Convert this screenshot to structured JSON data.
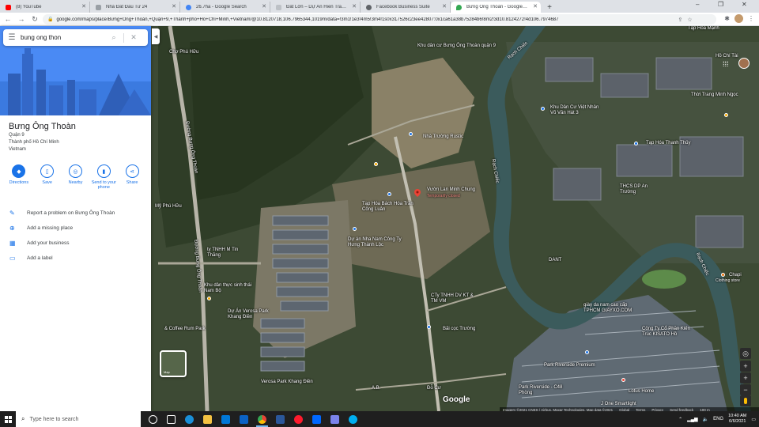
{
  "browser": {
    "tabs": [
      {
        "title": "(8) YouTube",
        "favicon_color": "#ff0000"
      },
      {
        "title": "Nhà Đất Đầu Tư 24",
        "favicon_color": "#5f6368"
      },
      {
        "title": "26.7ha - Google Search",
        "favicon_color": "#4285f4"
      },
      {
        "title": "Đất Lớn – Dự Án Hiền Trang – N",
        "favicon_color": "#9aa0a6"
      },
      {
        "title": "Facebook Business Suite",
        "favicon_color": "#5f6368"
      },
      {
        "title": "Bưng Ông Thoàn - Google Maps",
        "favicon_color": "#34a853",
        "active": true
      }
    ],
    "new_tab": "+",
    "window_controls": [
      "–",
      "❐",
      "✕"
    ],
    "url": "google.com/maps/place/Bưng+Ông+Thoàn,+Quận+9,+Thành+phố+Hồ+Chí+Minh,+Vietnam/@10.8120718,106.7965344,1019m/data=!3m1!1e3!4m5!3m4!1s0x317526c23ee42807:0x1ca61a38b75284b6!8m2!3d10.8124272!4d106.7974687"
  },
  "search": {
    "value": "bung ong thon"
  },
  "place": {
    "name": "Bưng Ông Thoàn",
    "address_lines": [
      "Quận 9",
      "Thành phố Hồ Chí Minh",
      "Vietnam"
    ]
  },
  "actions": [
    {
      "label": "Directions",
      "icon": "directions-icon",
      "glyph": "◆"
    },
    {
      "label": "Save",
      "icon": "bookmark-icon",
      "glyph": "▯"
    },
    {
      "label": "Nearby",
      "icon": "nearby-icon",
      "glyph": "◎"
    },
    {
      "label": "Send to your phone",
      "icon": "phone-icon",
      "glyph": "▮"
    },
    {
      "label": "Share",
      "icon": "share-icon",
      "glyph": "⋖"
    }
  ],
  "links": [
    {
      "label": "Report a problem on Bưng Ông Thoàn",
      "icon": "pencil-icon",
      "glyph": "✎"
    },
    {
      "label": "Add a missing place",
      "icon": "add-place-icon",
      "glyph": "⊕"
    },
    {
      "label": "Add your business",
      "icon": "business-icon",
      "glyph": "▦"
    },
    {
      "label": "Add a label",
      "icon": "label-icon",
      "glyph": "▭"
    }
  ],
  "map_labels": {
    "rach_chiec_1": "Rạch Chiếc",
    "rach_chiec_2": "Rạch Chiếc",
    "rach_chiec_3": "Rạch Chiếc",
    "poi_1": "Khu dân cư Bưng Ông Thoàn quận 9",
    "poi_2": "Nhà Trường Rustic",
    "poi_3": "Vườn Lan Minh Chung",
    "poi_3_sub": "Temporarily closed",
    "poi_4": "Tạp Hóa Bách Hóa Trần Công Luân",
    "poi_5": "Khu Dân Cư Việt Nhân Võ Văn Hát 3",
    "poi_6": "Tạp Hóa Thanh Thủy",
    "poi_7": "THCS DP An Trường",
    "poi_8": "Dự án Nha Nam Công Ty Hưng Thành Lộc",
    "poi_9": "Khu dân thực sinh thái Nam Bộ",
    "poi_10": "Dự Án Verosa Park Khang Điền",
    "poi_11": "CTy TNHH DV KT & TM VM",
    "poi_12": "Bãi cọc Trường",
    "poi_13": "DANT",
    "poi_14": "giày da nam cao cấp TPHCM GIAYXO.COM",
    "poi_15": "Công Ty Cổ Phần Kiến Trúc KISATO Hồ",
    "poi_16": "Park Riverside Premium",
    "poi_17": "Park Riverside - C48 Phòng",
    "poi_18": "Lotus Home",
    "poi_19": "Chapi",
    "poi_19_sub": "Clothing store",
    "poi_20": "Tạp Hóa Mạnh",
    "poi_21": "Thời Trang Minh Ngọc",
    "poi_22": "Chợ Phú Hữu",
    "poi_23": "Verosa Park Khang Điền",
    "poi_24": "& Coffee Rum Park",
    "poi_25": "Hồ Chí Tài",
    "poi_26": "ty TNHH M Tin Thăng",
    "poi_27": "Mỹ Phú Hữu",
    "poi_28": "Đường Bưng Ông Thoàn",
    "poi_29": "Đường Bưng Ông Thoàn",
    "poi_30": "J One Smartlight",
    "poi_31": "Đỗ Cư",
    "poi_32": "A.B."
  },
  "map_ui": {
    "google": "Google",
    "layer_label": "Map",
    "footer": [
      "Imagery ©2021 CNES / Airbus, Maxar Technologies, Map data ©2021",
      "Global",
      "Terms",
      "Privacy",
      "Send feedback",
      "100 m"
    ]
  },
  "taskbar": {
    "search_placeholder": "Type here to search",
    "apps": [
      {
        "name": "task-view",
        "color": "#ffffff"
      },
      {
        "name": "edge",
        "color": "#1a8fd8"
      },
      {
        "name": "file-explorer",
        "color": "#f4c242"
      },
      {
        "name": "store",
        "color": "#0078d7"
      },
      {
        "name": "mail",
        "color": "#0b62c4"
      },
      {
        "name": "chrome",
        "color": "#34a853",
        "active": true
      },
      {
        "name": "word",
        "color": "#2b579a"
      },
      {
        "name": "opera",
        "color": "#ff1b2d"
      },
      {
        "name": "zalo",
        "color": "#0068ff"
      },
      {
        "name": "teams",
        "color": "#7b83eb"
      },
      {
        "name": "skype",
        "color": "#00aff0"
      }
    ],
    "lang": "ENG",
    "time": "10:40 AM",
    "date": "6/6/2021"
  }
}
